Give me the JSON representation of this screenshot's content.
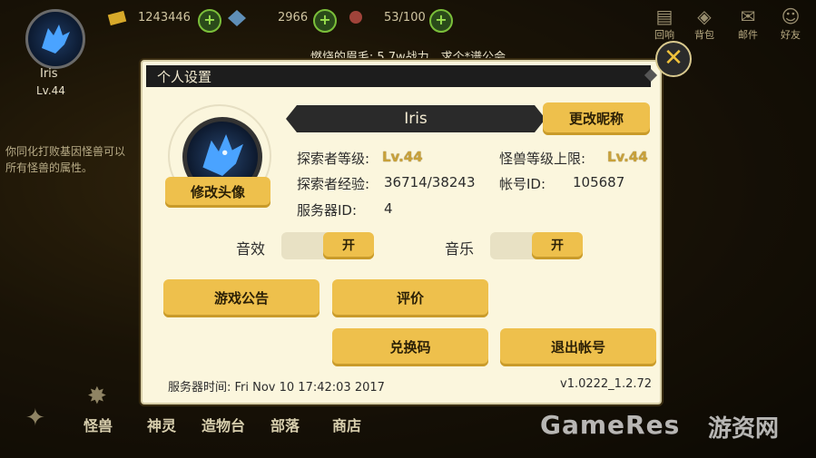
{
  "hud": {
    "player_name": "Iris",
    "player_level": "Lv.44",
    "gold": "1243446",
    "gems": "2966",
    "energy": "53/100",
    "top_buttons": [
      {
        "label": "回响",
        "icon": "scroll-icon"
      },
      {
        "label": "背包",
        "icon": "bag-icon"
      },
      {
        "label": "邮件",
        "icon": "mail-icon"
      },
      {
        "label": "好友",
        "icon": "friends-icon"
      }
    ]
  },
  "notice_text": "燃烧的眉毛: 5.7w战力，求个*谱公会",
  "side_text": [
    "你同化打败基因怪兽可以",
    "所有怪兽的属性。"
  ],
  "bottom_nav": [
    "怪兽",
    "神灵",
    "造物台",
    "部落",
    "商店"
  ],
  "watermark": {
    "latin": "GameRes",
    "cn": "游资网"
  },
  "dialog": {
    "title": "个人设置",
    "close_glyph": "✕",
    "change_avatar": "修改头像",
    "nickname": "Iris",
    "change_nickname": "更改昵称",
    "explorer_level_label": "探索者等级:",
    "explorer_level_value": "Lv.44",
    "monster_cap_label": "怪兽等级上限:",
    "monster_cap_value": "Lv.44",
    "explorer_exp_label": "探索者经验:",
    "explorer_exp_value": "36714/38243",
    "account_id_label": "帐号ID:",
    "account_id_value": "105687",
    "server_id_label": "服务器ID:",
    "server_id_value": "4",
    "sound_label": "音效",
    "sound_state": "开",
    "music_label": "音乐",
    "music_state": "开",
    "btn_announcement": "游戏公告",
    "btn_review": "评价",
    "btn_redeem": "兑换码",
    "btn_logout": "退出帐号",
    "server_time": "服务器时间: Fri Nov 10 17:42:03 2017",
    "version": "v1.0222_1.2.72"
  },
  "colors": {
    "accent": "#eec04c",
    "panel": "#fbf6dd",
    "title_bar": "#1d1d1d"
  }
}
